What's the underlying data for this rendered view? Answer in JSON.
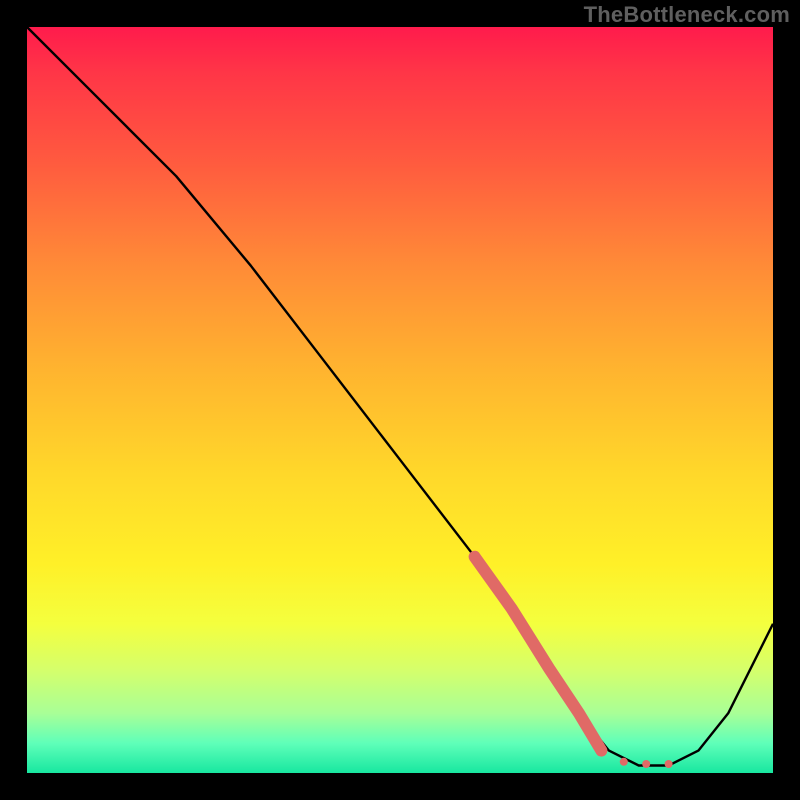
{
  "watermark": "TheBottleneck.com",
  "chart_data": {
    "type": "line",
    "title": "",
    "xlabel": "",
    "ylabel": "",
    "xlim": [
      0,
      100
    ],
    "ylim": [
      0,
      100
    ],
    "series": [
      {
        "name": "bottleneck-curve",
        "x": [
          0,
          8,
          20,
          30,
          40,
          50,
          60,
          65,
          70,
          74,
          78,
          82,
          86,
          90,
          94,
          100
        ],
        "values": [
          100,
          92,
          80,
          68,
          55,
          42,
          29,
          22,
          14,
          8,
          3,
          1,
          1,
          3,
          8,
          20
        ]
      }
    ],
    "highlight_segment": {
      "name": "highlighted-range",
      "color": "#e06a66",
      "points": [
        {
          "x": 60,
          "y": 29,
          "r": 5
        },
        {
          "x": 65,
          "y": 22,
          "r": 5
        },
        {
          "x": 70,
          "y": 14,
          "r": 5
        },
        {
          "x": 74,
          "y": 8,
          "r": 5
        },
        {
          "x": 77,
          "y": 3,
          "r": 4
        },
        {
          "x": 80,
          "y": 1.5,
          "r": 4
        },
        {
          "x": 83,
          "y": 1.2,
          "r": 4
        },
        {
          "x": 86,
          "y": 1.2,
          "r": 4
        }
      ]
    }
  }
}
